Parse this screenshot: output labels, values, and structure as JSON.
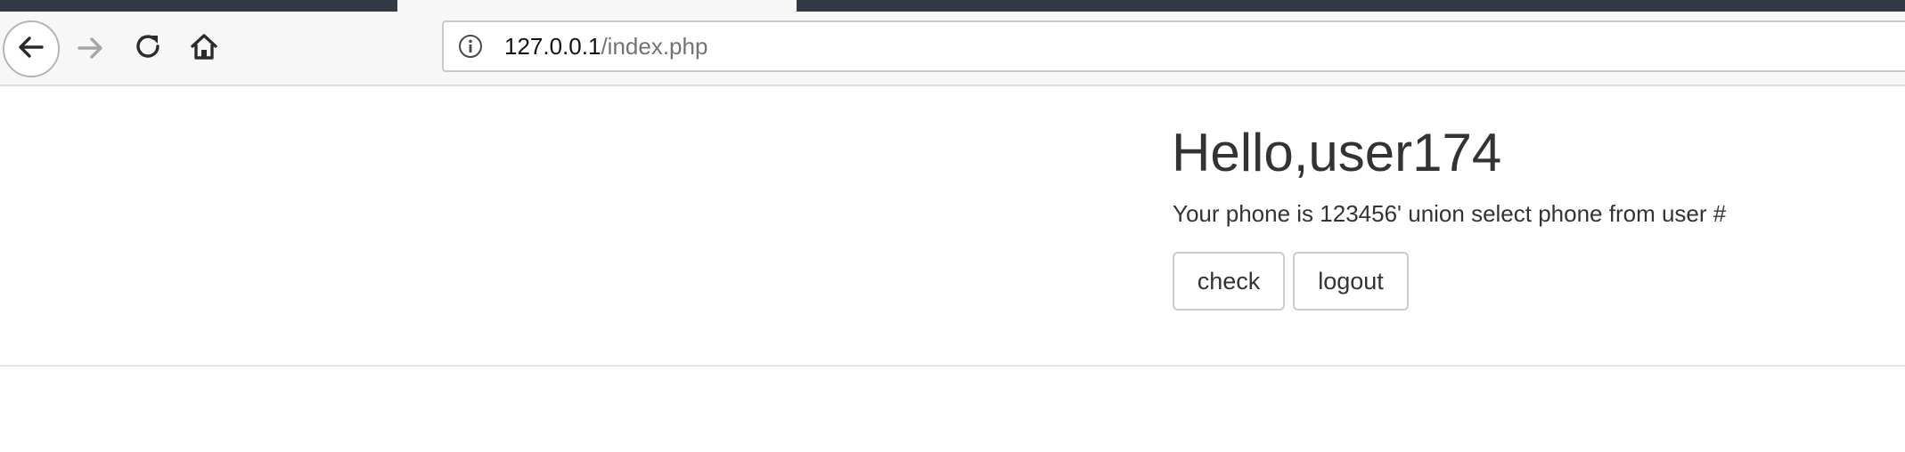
{
  "browser": {
    "url_host": "127.0.0.1",
    "url_path": "/index.php",
    "icons": {
      "back": "arrow-left-icon",
      "forward": "arrow-right-icon",
      "reload": "reload-icon",
      "home": "home-icon",
      "info": "info-icon"
    }
  },
  "page": {
    "greeting": "Hello,user174",
    "phone_line": "Your phone is 123456' union select phone from user #",
    "buttons": {
      "check_label": "check",
      "logout_label": "logout"
    }
  },
  "colors": {
    "tabstrip": "#323b45",
    "toolbar": "#f7f7f7",
    "text": "#333333",
    "button_border": "#cccccc"
  }
}
